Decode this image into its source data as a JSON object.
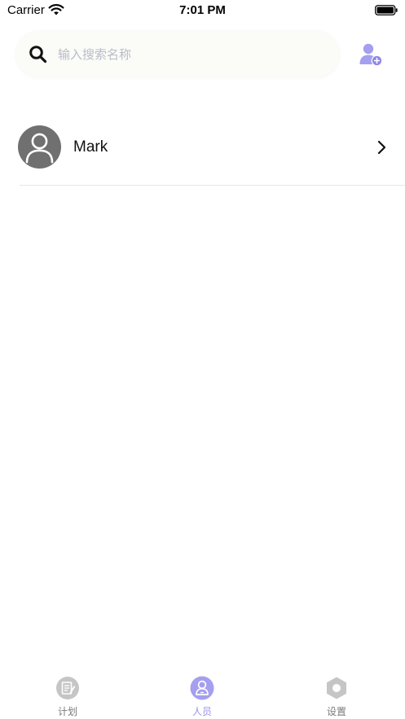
{
  "status_bar": {
    "carrier": "Carrier",
    "time": "7:01 PM"
  },
  "search": {
    "placeholder": "输入搜索名称",
    "value": ""
  },
  "people": [
    {
      "name": "Mark"
    }
  ],
  "tabs": [
    {
      "label": "计划",
      "icon": "plan-icon",
      "active": false
    },
    {
      "label": "人员",
      "icon": "person-icon",
      "active": true
    },
    {
      "label": "设置",
      "icon": "settings-icon",
      "active": false
    }
  ],
  "colors": {
    "accent": "#9b94ec",
    "inactive_tab": "#c5c5c5",
    "avatar_bg": "#707070",
    "placeholder": "#b9bcc6"
  }
}
